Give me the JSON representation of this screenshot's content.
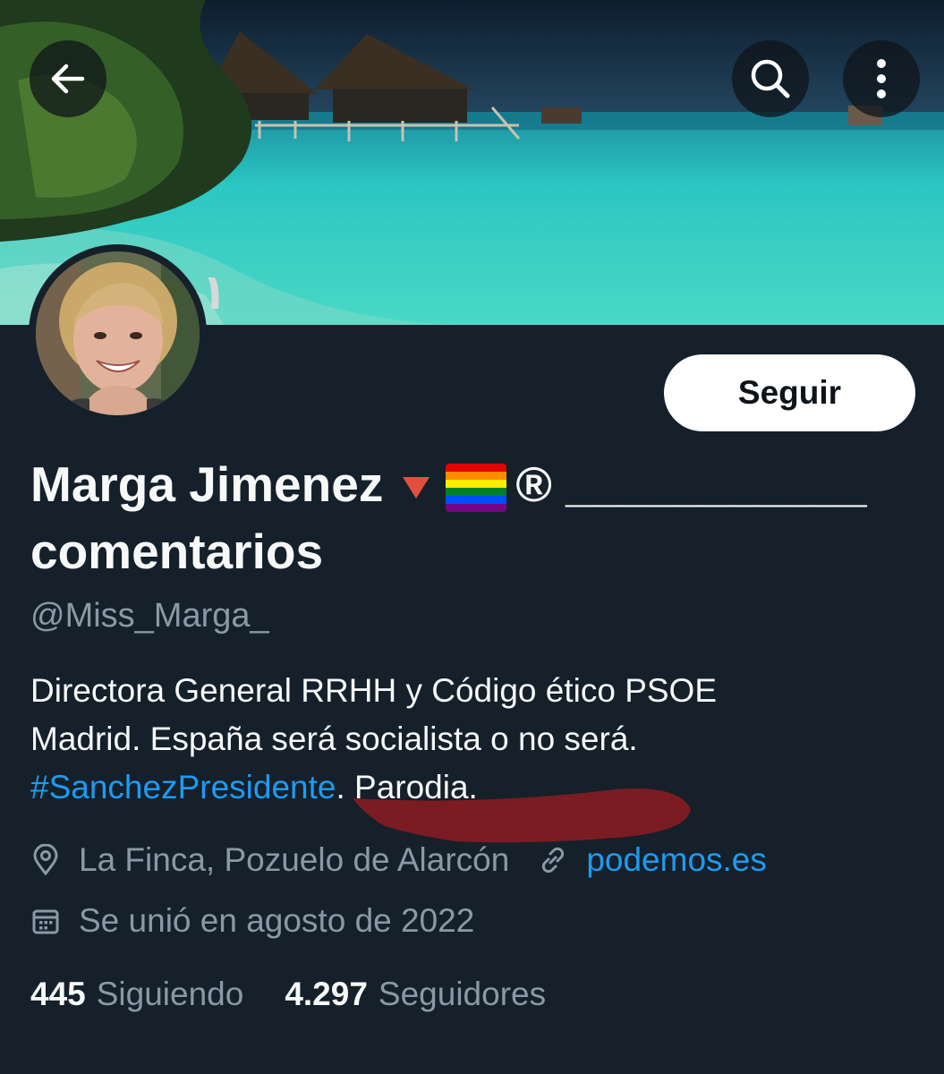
{
  "header": {
    "back_icon": "arrow-left-icon",
    "search_icon": "search-icon",
    "more_icon": "more-vertical-icon"
  },
  "profile": {
    "name_text": "Marga Jimenez",
    "name_symbol": "®",
    "name_underline": "___________",
    "name_line2": "comentarios",
    "handle": "@Miss_Marga_",
    "follow_label": "Seguir",
    "bio_line1": "Directora General RRHH y Código ético PSOE",
    "bio_line2": "Madrid. España será socialista o no será.",
    "bio_hashtag": "#SanchezPresidente",
    "bio_tail": ". Parodia.",
    "location": "La Finca, Pozuelo de Alarcón",
    "website": "podemos.es",
    "joined": "Se unió en agosto de 2022",
    "following_count": "445",
    "following_label": "Siguiendo",
    "followers_count": "4.297",
    "followers_label": "Seguidores"
  },
  "colors": {
    "background": "#15202b",
    "accent": "#1d9bf0",
    "secondary_text": "#8b98a5",
    "scribble": "#7a1c22"
  }
}
